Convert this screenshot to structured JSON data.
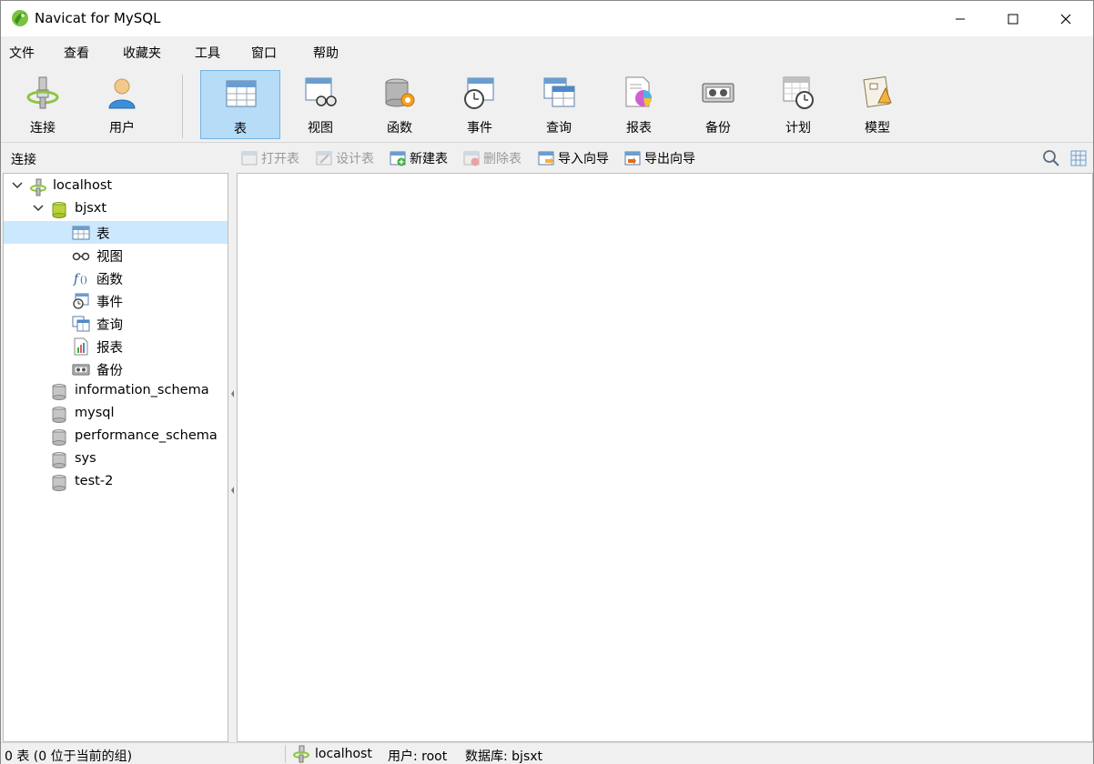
{
  "window": {
    "title": "Navicat for MySQL"
  },
  "menu": {
    "items": [
      "文件",
      "查看",
      "收藏夹",
      "工具",
      "窗口",
      "帮助"
    ]
  },
  "toolbar": {
    "items": [
      {
        "label": "连接",
        "icon": "connection-icon"
      },
      {
        "label": "用户",
        "icon": "user-icon"
      },
      {
        "label": "表",
        "icon": "table-icon",
        "active": true
      },
      {
        "label": "视图",
        "icon": "view-icon"
      },
      {
        "label": "函数",
        "icon": "function-icon"
      },
      {
        "label": "事件",
        "icon": "event-icon"
      },
      {
        "label": "查询",
        "icon": "query-icon"
      },
      {
        "label": "报表",
        "icon": "report-icon"
      },
      {
        "label": "备份",
        "icon": "backup-icon"
      },
      {
        "label": "计划",
        "icon": "schedule-icon"
      },
      {
        "label": "模型",
        "icon": "model-icon"
      }
    ]
  },
  "left_pane": {
    "header": "连接"
  },
  "object_toolbar": {
    "open_table": "打开表",
    "design_table": "设计表",
    "new_table": "新建表",
    "delete_table": "删除表",
    "import_wizard": "导入向导",
    "export_wizard": "导出向导"
  },
  "tree": {
    "connection": "localhost",
    "database": "bjsxt",
    "objects": [
      "表",
      "视图",
      "函数",
      "事件",
      "查询",
      "报表",
      "备份"
    ],
    "other_databases": [
      "information_schema",
      "mysql",
      "performance_schema",
      "sys",
      "test-2"
    ]
  },
  "status": {
    "left": "0 表 (0 位于当前的组)",
    "connection": "localhost",
    "user": "用户: root",
    "database": "数据库: bjsxt"
  },
  "colors": {
    "selection": "#cce8ff",
    "active_tool": "#b7dcf7",
    "active_tool_border": "#74b4e3"
  }
}
